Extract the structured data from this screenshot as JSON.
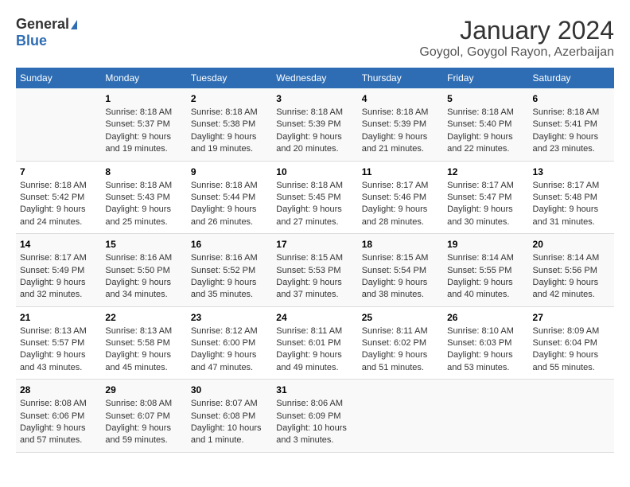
{
  "logo": {
    "general": "General",
    "blue": "Blue"
  },
  "title": "January 2024",
  "subtitle": "Goygol, Goygol Rayon, Azerbaijan",
  "days_of_week": [
    "Sunday",
    "Monday",
    "Tuesday",
    "Wednesday",
    "Thursday",
    "Friday",
    "Saturday"
  ],
  "weeks": [
    [
      {
        "day": "",
        "sunrise": "",
        "sunset": "",
        "daylight": ""
      },
      {
        "day": "1",
        "sunrise": "Sunrise: 8:18 AM",
        "sunset": "Sunset: 5:37 PM",
        "daylight": "Daylight: 9 hours and 19 minutes."
      },
      {
        "day": "2",
        "sunrise": "Sunrise: 8:18 AM",
        "sunset": "Sunset: 5:38 PM",
        "daylight": "Daylight: 9 hours and 19 minutes."
      },
      {
        "day": "3",
        "sunrise": "Sunrise: 8:18 AM",
        "sunset": "Sunset: 5:39 PM",
        "daylight": "Daylight: 9 hours and 20 minutes."
      },
      {
        "day": "4",
        "sunrise": "Sunrise: 8:18 AM",
        "sunset": "Sunset: 5:39 PM",
        "daylight": "Daylight: 9 hours and 21 minutes."
      },
      {
        "day": "5",
        "sunrise": "Sunrise: 8:18 AM",
        "sunset": "Sunset: 5:40 PM",
        "daylight": "Daylight: 9 hours and 22 minutes."
      },
      {
        "day": "6",
        "sunrise": "Sunrise: 8:18 AM",
        "sunset": "Sunset: 5:41 PM",
        "daylight": "Daylight: 9 hours and 23 minutes."
      }
    ],
    [
      {
        "day": "7",
        "sunrise": "Sunrise: 8:18 AM",
        "sunset": "Sunset: 5:42 PM",
        "daylight": "Daylight: 9 hours and 24 minutes."
      },
      {
        "day": "8",
        "sunrise": "Sunrise: 8:18 AM",
        "sunset": "Sunset: 5:43 PM",
        "daylight": "Daylight: 9 hours and 25 minutes."
      },
      {
        "day": "9",
        "sunrise": "Sunrise: 8:18 AM",
        "sunset": "Sunset: 5:44 PM",
        "daylight": "Daylight: 9 hours and 26 minutes."
      },
      {
        "day": "10",
        "sunrise": "Sunrise: 8:18 AM",
        "sunset": "Sunset: 5:45 PM",
        "daylight": "Daylight: 9 hours and 27 minutes."
      },
      {
        "day": "11",
        "sunrise": "Sunrise: 8:17 AM",
        "sunset": "Sunset: 5:46 PM",
        "daylight": "Daylight: 9 hours and 28 minutes."
      },
      {
        "day": "12",
        "sunrise": "Sunrise: 8:17 AM",
        "sunset": "Sunset: 5:47 PM",
        "daylight": "Daylight: 9 hours and 30 minutes."
      },
      {
        "day": "13",
        "sunrise": "Sunrise: 8:17 AM",
        "sunset": "Sunset: 5:48 PM",
        "daylight": "Daylight: 9 hours and 31 minutes."
      }
    ],
    [
      {
        "day": "14",
        "sunrise": "Sunrise: 8:17 AM",
        "sunset": "Sunset: 5:49 PM",
        "daylight": "Daylight: 9 hours and 32 minutes."
      },
      {
        "day": "15",
        "sunrise": "Sunrise: 8:16 AM",
        "sunset": "Sunset: 5:50 PM",
        "daylight": "Daylight: 9 hours and 34 minutes."
      },
      {
        "day": "16",
        "sunrise": "Sunrise: 8:16 AM",
        "sunset": "Sunset: 5:52 PM",
        "daylight": "Daylight: 9 hours and 35 minutes."
      },
      {
        "day": "17",
        "sunrise": "Sunrise: 8:15 AM",
        "sunset": "Sunset: 5:53 PM",
        "daylight": "Daylight: 9 hours and 37 minutes."
      },
      {
        "day": "18",
        "sunrise": "Sunrise: 8:15 AM",
        "sunset": "Sunset: 5:54 PM",
        "daylight": "Daylight: 9 hours and 38 minutes."
      },
      {
        "day": "19",
        "sunrise": "Sunrise: 8:14 AM",
        "sunset": "Sunset: 5:55 PM",
        "daylight": "Daylight: 9 hours and 40 minutes."
      },
      {
        "day": "20",
        "sunrise": "Sunrise: 8:14 AM",
        "sunset": "Sunset: 5:56 PM",
        "daylight": "Daylight: 9 hours and 42 minutes."
      }
    ],
    [
      {
        "day": "21",
        "sunrise": "Sunrise: 8:13 AM",
        "sunset": "Sunset: 5:57 PM",
        "daylight": "Daylight: 9 hours and 43 minutes."
      },
      {
        "day": "22",
        "sunrise": "Sunrise: 8:13 AM",
        "sunset": "Sunset: 5:58 PM",
        "daylight": "Daylight: 9 hours and 45 minutes."
      },
      {
        "day": "23",
        "sunrise": "Sunrise: 8:12 AM",
        "sunset": "Sunset: 6:00 PM",
        "daylight": "Daylight: 9 hours and 47 minutes."
      },
      {
        "day": "24",
        "sunrise": "Sunrise: 8:11 AM",
        "sunset": "Sunset: 6:01 PM",
        "daylight": "Daylight: 9 hours and 49 minutes."
      },
      {
        "day": "25",
        "sunrise": "Sunrise: 8:11 AM",
        "sunset": "Sunset: 6:02 PM",
        "daylight": "Daylight: 9 hours and 51 minutes."
      },
      {
        "day": "26",
        "sunrise": "Sunrise: 8:10 AM",
        "sunset": "Sunset: 6:03 PM",
        "daylight": "Daylight: 9 hours and 53 minutes."
      },
      {
        "day": "27",
        "sunrise": "Sunrise: 8:09 AM",
        "sunset": "Sunset: 6:04 PM",
        "daylight": "Daylight: 9 hours and 55 minutes."
      }
    ],
    [
      {
        "day": "28",
        "sunrise": "Sunrise: 8:08 AM",
        "sunset": "Sunset: 6:06 PM",
        "daylight": "Daylight: 9 hours and 57 minutes."
      },
      {
        "day": "29",
        "sunrise": "Sunrise: 8:08 AM",
        "sunset": "Sunset: 6:07 PM",
        "daylight": "Daylight: 9 hours and 59 minutes."
      },
      {
        "day": "30",
        "sunrise": "Sunrise: 8:07 AM",
        "sunset": "Sunset: 6:08 PM",
        "daylight": "Daylight: 10 hours and 1 minute."
      },
      {
        "day": "31",
        "sunrise": "Sunrise: 8:06 AM",
        "sunset": "Sunset: 6:09 PM",
        "daylight": "Daylight: 10 hours and 3 minutes."
      },
      {
        "day": "",
        "sunrise": "",
        "sunset": "",
        "daylight": ""
      },
      {
        "day": "",
        "sunrise": "",
        "sunset": "",
        "daylight": ""
      },
      {
        "day": "",
        "sunrise": "",
        "sunset": "",
        "daylight": ""
      }
    ]
  ]
}
